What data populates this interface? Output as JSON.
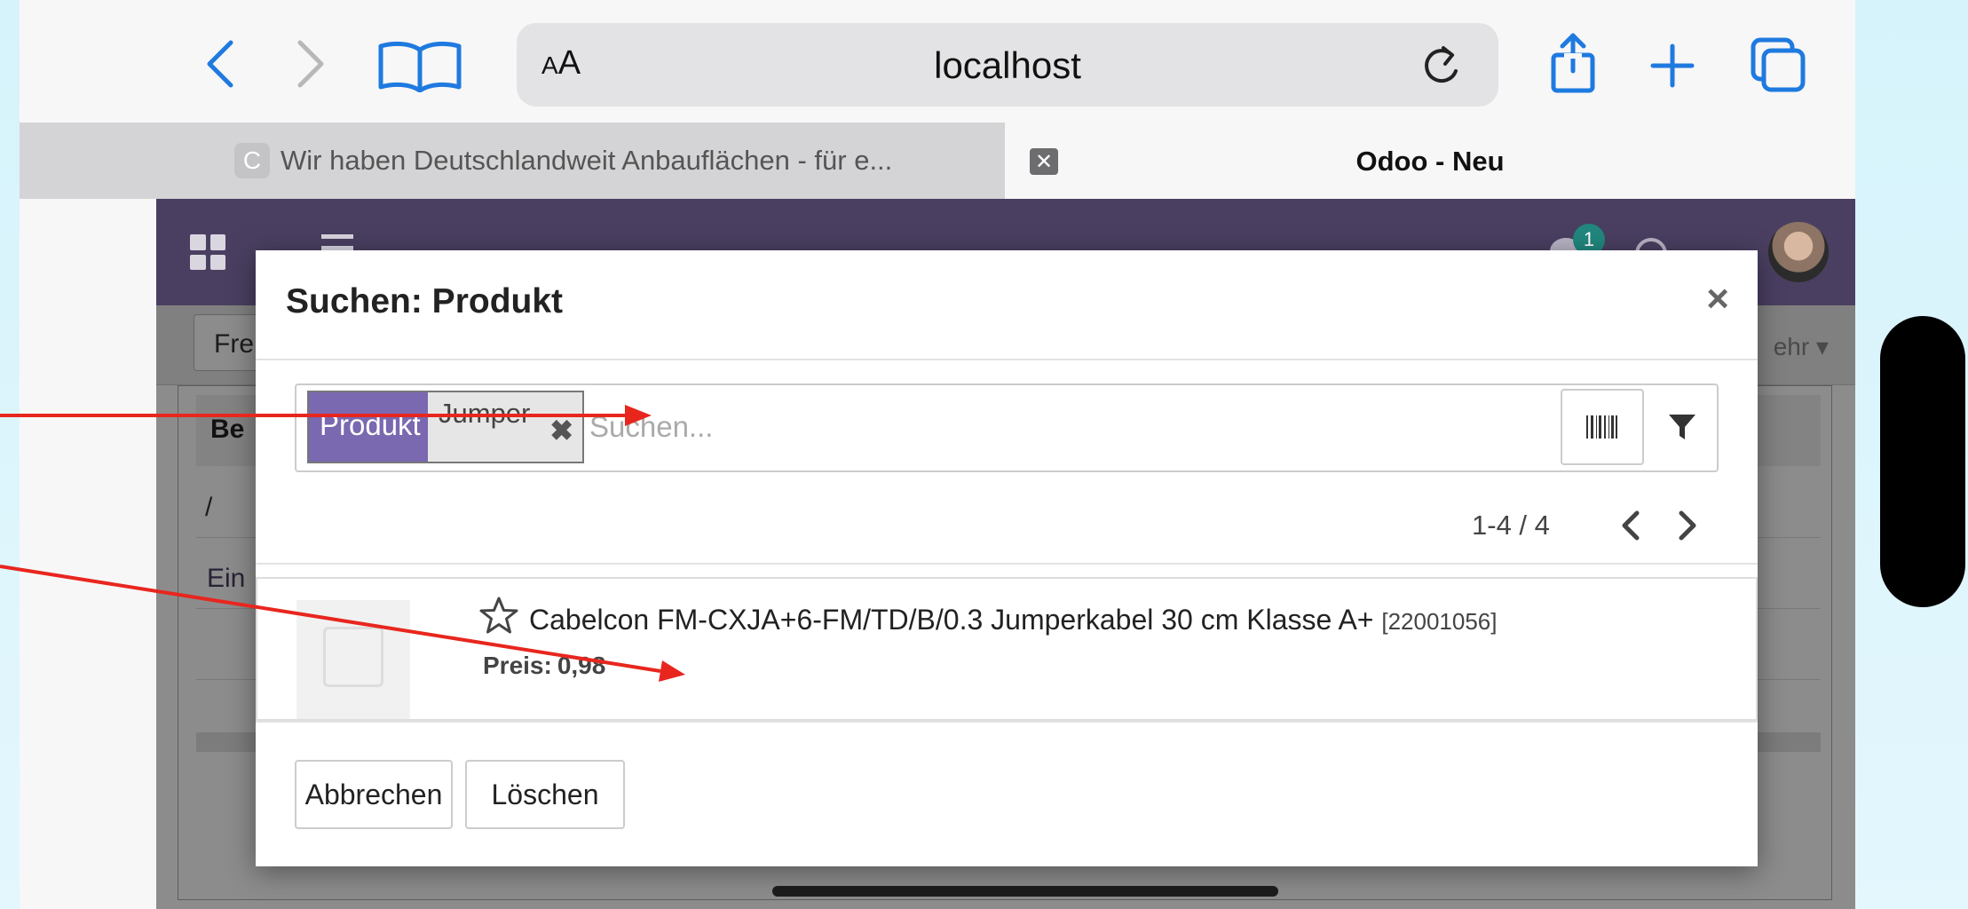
{
  "browser": {
    "aa_label_small": "A",
    "aa_label_large": "A",
    "url": "localhost",
    "tabs": [
      {
        "favicon_letter": "C",
        "title": "Wir haben Deutschlandweit Anbauflächen - für e..."
      },
      {
        "title": "Odoo - Neu"
      }
    ]
  },
  "odoo": {
    "notification_count": "1",
    "control_panel_button": "Fre",
    "more_label": "ehr",
    "sheet_header": "Be",
    "sheet_value": "/",
    "sheet_link": "Ein"
  },
  "dialog": {
    "title": "Suchen: Produkt",
    "close_glyph": "×",
    "facet": {
      "category": "Produkt",
      "value": "Jumper",
      "remove_glyph": "✖"
    },
    "search_placeholder": "Suchen...",
    "pager": "1-4 / 4",
    "results": [
      {
        "name": "Cabelcon FM-CXJA+6-FM/TD/B/0.3 Jumperkabel 30 cm Klasse A+",
        "code": "[22001056]",
        "price_label": "Preis:",
        "price": "0,98"
      }
    ],
    "cancel_label": "Abbrechen",
    "clear_label": "Löschen"
  },
  "colors": {
    "odoo_nav": "#4a3f61",
    "facet_category": "#7a68b0",
    "annotation_arrow": "#e8261e",
    "badge": "#21887f"
  },
  "icons": [
    "back-icon",
    "forward-icon",
    "bookmarks-icon",
    "reload-icon",
    "share-icon",
    "new-tab-icon",
    "tabs-icon",
    "apps-icon",
    "menu-icon",
    "barcode-icon",
    "filter-icon",
    "star-icon",
    "chevron-left-icon",
    "chevron-right-icon"
  ]
}
